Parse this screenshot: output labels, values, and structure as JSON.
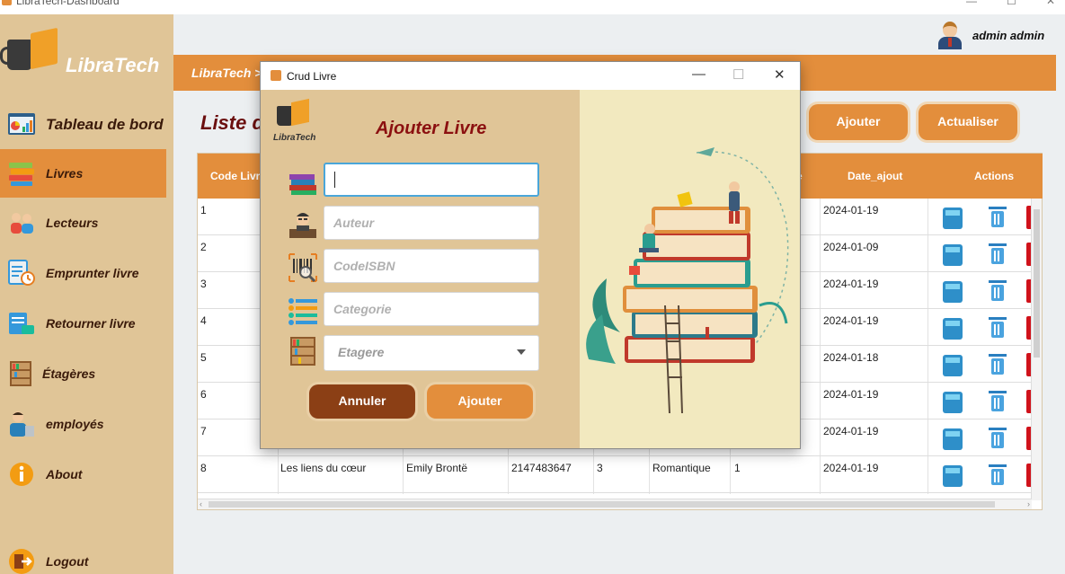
{
  "window": {
    "title": "LibraTech-Dashboard"
  },
  "sidebar": {
    "brand": "LibraTech",
    "items": [
      {
        "label": "Tableau de bord",
        "icon": "dashboard-icon"
      },
      {
        "label": "Livres",
        "icon": "books-icon",
        "active": true
      },
      {
        "label": "Lecteurs",
        "icon": "readers-icon"
      },
      {
        "label": "Emprunter livre",
        "icon": "borrow-icon"
      },
      {
        "label": "Retourner livre",
        "icon": "return-icon"
      },
      {
        "label": "Étagères",
        "icon": "shelves-icon"
      },
      {
        "label": "employés",
        "icon": "employees-icon"
      },
      {
        "label": "About",
        "icon": "info-icon"
      }
    ],
    "logout": "Logout"
  },
  "header": {
    "user": "admin admin",
    "breadcrumb": "LibraTech >"
  },
  "main": {
    "title": "Liste d",
    "buttons": {
      "add": "Ajouter",
      "refresh": "Actualiser"
    },
    "table": {
      "headers": {
        "code": "Code Livre",
        "date": "Date_ajout",
        "actions": "Actions",
        "partial": "e"
      },
      "rows": [
        {
          "code": "1",
          "date": "2024-01-19"
        },
        {
          "code": "2",
          "date": "2024-01-09"
        },
        {
          "code": "3",
          "date": "2024-01-19"
        },
        {
          "code": "4",
          "date": "2024-01-19"
        },
        {
          "code": "5",
          "date": "2024-01-18"
        },
        {
          "code": "6",
          "date": "2024-01-19"
        },
        {
          "code": "7",
          "date": "2024-01-19"
        },
        {
          "code": "8",
          "title": "Les liens du cœur",
          "author": "Emily Brontë",
          "isbn": "2147483647",
          "qty": "3",
          "category": "Romantique",
          "shelf": "1",
          "date": "2024-01-19"
        }
      ]
    }
  },
  "dialog": {
    "title": "Crud Livre",
    "logo": "LibraTech",
    "heading": "Ajouter Livre",
    "fields": {
      "title_value": "",
      "author_placeholder": "Auteur",
      "isbn_placeholder": "CodeISBN",
      "category_placeholder": "Categorie",
      "shelf_selected": "Etagere"
    },
    "buttons": {
      "cancel": "Annuler",
      "add": "Ajouter"
    }
  },
  "colors": {
    "accent": "#e38e3c",
    "sidebar": "#e0c597",
    "heading": "#8b1010",
    "cancel": "#8b3f15"
  }
}
